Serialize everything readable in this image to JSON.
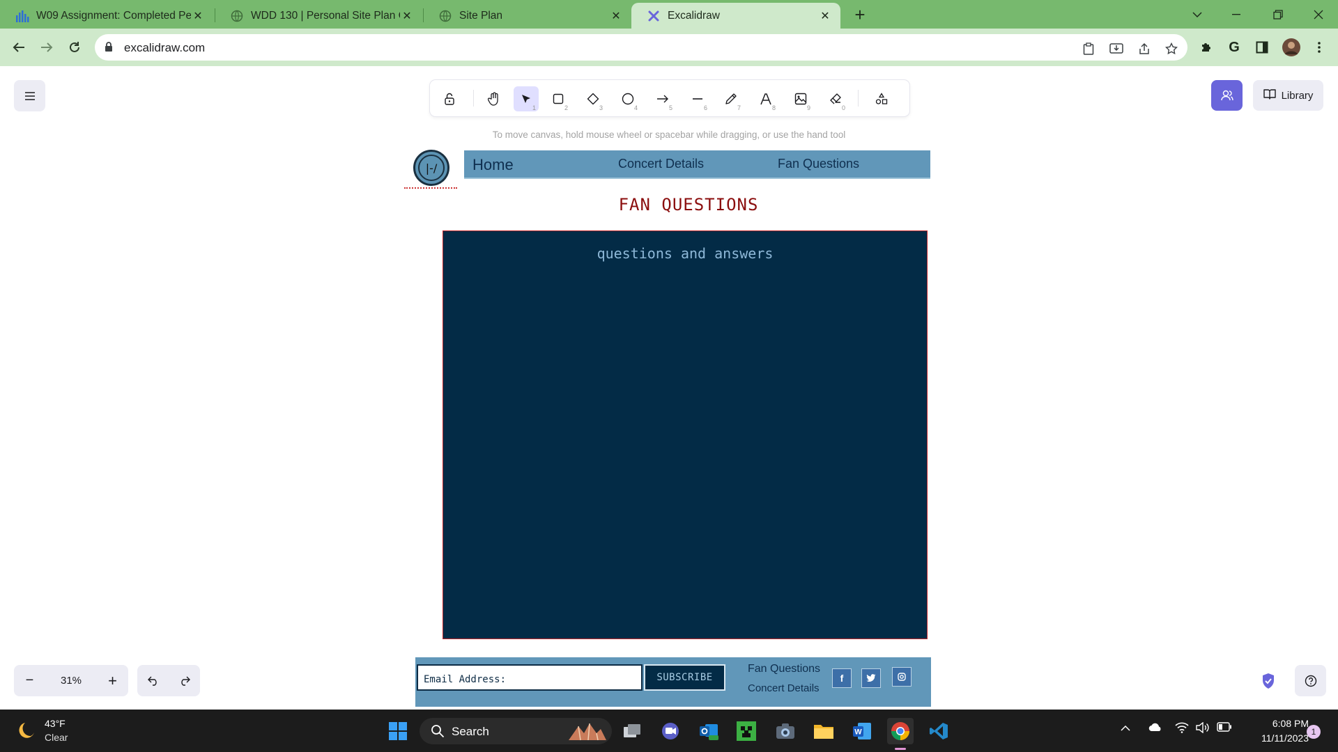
{
  "browser": {
    "tabs": [
      {
        "title": "W09 Assignment: Completed Pe",
        "favicon": "bar-chart-icon"
      },
      {
        "title": "WDD 130 | Personal Site Plan Co",
        "favicon": "globe-icon"
      },
      {
        "title": "Site Plan",
        "favicon": "globe-icon"
      },
      {
        "title": "Excalidraw",
        "favicon": "excalidraw-icon",
        "active": true
      }
    ],
    "url": "excalidraw.com"
  },
  "excalidraw": {
    "hint": "To move canvas, hold mouse wheel or spacebar while dragging, or use the hand tool",
    "tools": [
      {
        "name": "lock",
        "key": ""
      },
      {
        "name": "hand",
        "key": ""
      },
      {
        "name": "selection",
        "key": "1"
      },
      {
        "name": "rectangle",
        "key": "2"
      },
      {
        "name": "diamond",
        "key": "3"
      },
      {
        "name": "ellipse",
        "key": "4"
      },
      {
        "name": "arrow",
        "key": "5"
      },
      {
        "name": "line",
        "key": "6"
      },
      {
        "name": "draw",
        "key": "7"
      },
      {
        "name": "text",
        "key": "8"
      },
      {
        "name": "image",
        "key": "9"
      },
      {
        "name": "eraser",
        "key": "0"
      },
      {
        "name": "extra-tools",
        "key": ""
      }
    ],
    "library_label": "Library",
    "zoom": "31%"
  },
  "drawing": {
    "logo_text": "|-/",
    "nav": {
      "home": "Home",
      "concert": "Concert Details",
      "fan": "Fan Questions"
    },
    "heading": "FAN QUESTIONS",
    "qa_title": "questions and answers",
    "footer": {
      "email_placeholder": "Email Address:",
      "subscribe": "SUBSCRIBE",
      "link_fan": "Fan Questions",
      "link_concert": "Concert Details"
    }
  },
  "taskbar": {
    "temp": "43°F",
    "condition": "Clear",
    "search": "Search",
    "time": "6:08 PM",
    "date": "11/11/2023",
    "notifications": "1"
  },
  "colors": {
    "tab_strip": "#77b96e",
    "toolbar": "#cfe9cb",
    "nav_blue": "#6197b9",
    "qa_navy": "#032b46",
    "heading_red": "#8b0e0e",
    "excalidraw_purple": "#6965db"
  }
}
